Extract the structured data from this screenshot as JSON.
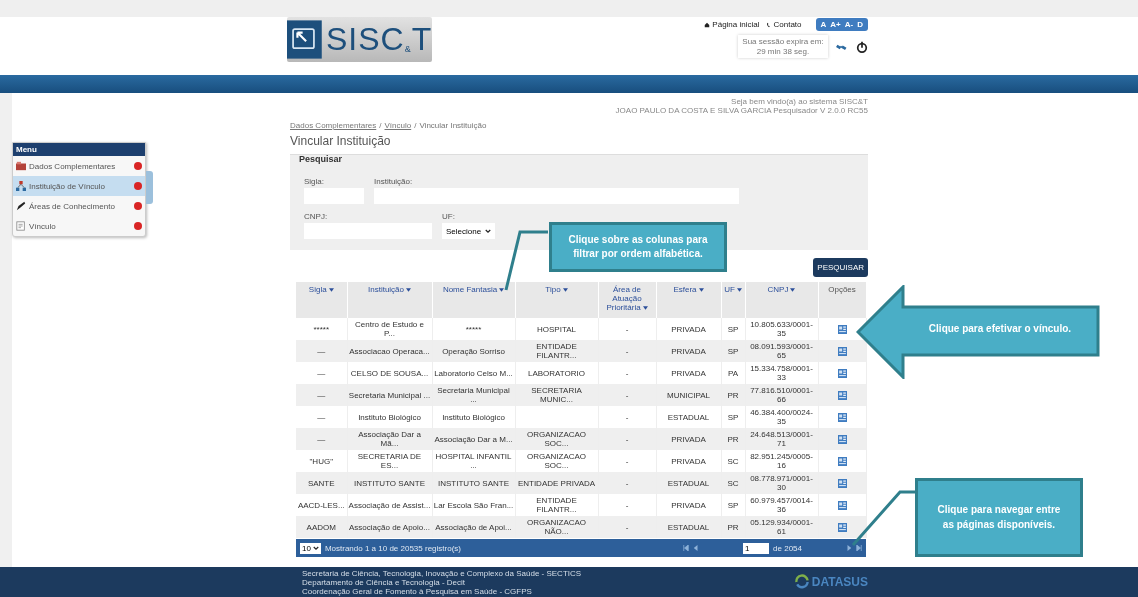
{
  "header": {
    "logo": "SISC$_{&}$T",
    "links": [
      {
        "label": "Página inicial"
      },
      {
        "label": "Contato"
      }
    ],
    "font_buttons": [
      "A",
      "A+",
      "A-",
      "D"
    ],
    "session": "Sua sessão expira em: 29 min 38 seg."
  },
  "menu": {
    "title": "Menu",
    "items": [
      {
        "label": "Dados Complementares",
        "selected": false
      },
      {
        "label": "Instituição de Vínculo",
        "selected": true
      },
      {
        "label": "Áreas de Conhecimento",
        "selected": false
      },
      {
        "label": "Vínculo",
        "selected": false
      }
    ]
  },
  "welcome": [
    "Seja bem vindo(a) ao sistema SISC&T",
    "JOAO PAULO DA COSTA E SILVA GARCIA Pesquisador V 2.0.0 RC55"
  ],
  "breadcrumb_separator": "/",
  "breadcrumb": [
    {
      "label": "Dados Complementares",
      "link": true
    },
    {
      "label": "Vínculo",
      "link": true
    },
    {
      "label": "Vincular Instituição",
      "link": false
    }
  ],
  "page_title": "Vincular Instituição",
  "search": {
    "legend": "Pesquisar",
    "sigla_label": "Sigla:",
    "instituicao_label": "Instituição:",
    "cnpj_label": "CNPJ:",
    "uf_label": "UF:",
    "uf_value": "Selecione",
    "button": "PESQUISAR"
  },
  "table": {
    "columns": [
      {
        "label": "Sigla",
        "sortable": true
      },
      {
        "label": "Instituição",
        "sortable": true
      },
      {
        "label": "Nome Fantasia",
        "sortable": true
      },
      {
        "label": "Tipo",
        "sortable": true
      },
      {
        "label": "Área de Atuação Prioritária",
        "sortable": true
      },
      {
        "label": "Esfera",
        "sortable": true
      },
      {
        "label": "UF",
        "sortable": true
      },
      {
        "label": "CNPJ",
        "sortable": true
      },
      {
        "label": "Opções",
        "sortable": false
      }
    ],
    "rows": [
      [
        "*****",
        "Centro de Estudo e P...",
        "*****",
        "HOSPITAL",
        "-",
        "PRIVADA",
        "SP",
        "10.805.633/0001-35"
      ],
      [
        "—",
        "Associacao Operaca...",
        "Operação Sorriso",
        "ENTIDADE FILANTR...",
        "-",
        "PRIVADA",
        "SP",
        "08.091.593/0001-65"
      ],
      [
        "—",
        "CELSO DE SOUSA...",
        "Laboratorio Celso M...",
        "LABORATORIO",
        "-",
        "PRIVADA",
        "PA",
        "15.334.758/0001-33"
      ],
      [
        "—",
        "Secretaria Municipal ...",
        "Secretaria Municipal ...",
        "SECRETARIA MUNIC...",
        "-",
        "MUNICIPAL",
        "PR",
        "77.816.510/0001-66"
      ],
      [
        "—",
        "Instituto Biológico",
        "Instituto Biológico",
        null,
        "-",
        "ESTADUAL",
        "SP",
        "46.384.400/0024-35"
      ],
      [
        "—",
        "Associação Dar a Mã...",
        "Associação Dar a M...",
        "ORGANIZACAO SOC...",
        "-",
        "PRIVADA",
        "PR",
        "24.648.513/0001-71"
      ],
      [
        "\"HUG\"",
        "SECRETARIA DE ES...",
        "HOSPITAL INFANTIL ...",
        "ORGANIZACAO SOC...",
        "-",
        "PRIVADA",
        "SC",
        "82.951.245/0005-16"
      ],
      [
        "SANTE",
        "INSTITUTO SANTE",
        "INSTITUTO SANTE",
        "ENTIDADE PRIVADA",
        "-",
        "ESTADUAL",
        "SC",
        "08.778.971/0001-30"
      ],
      [
        "AACD-LES...",
        "Associação de Assist...",
        "Lar Escola São Fran...",
        "ENTIDADE FILANTR...",
        "-",
        "PRIVADA",
        "SP",
        "60.979.457/0014-36"
      ],
      [
        "AADOM",
        "Associação de Apoio...",
        "Associação de Apoi...",
        "ORGANIZACAO NÃO...",
        "-",
        "ESTADUAL",
        "PR",
        "05.129.934/0001-61"
      ]
    ]
  },
  "pagination": {
    "page_size": "10",
    "summary": "Mostrando 1 a 10 de 20535 registro(s)",
    "page": "1",
    "total": "de 2054"
  },
  "footer": {
    "lines": [
      "Secretaria de Ciência, Tecnologia, Inovação e Complexo da Saúde - SECTICS",
      "Departamento de Ciência e Tecnologia - Decit",
      "Coordenação Geral de Fomento à Pesquisa em Saúde - CGFPS"
    ],
    "logo": "DATASUS"
  },
  "callouts": [
    {
      "kind": "box",
      "text": "Clique sobre as colunas para filtrar por ordem alfabética."
    },
    {
      "kind": "arrow",
      "text": "Clique para efetivar o vínculo."
    },
    {
      "kind": "box",
      "text": "Clique para navegar entre as páginas disponíveis."
    }
  ]
}
